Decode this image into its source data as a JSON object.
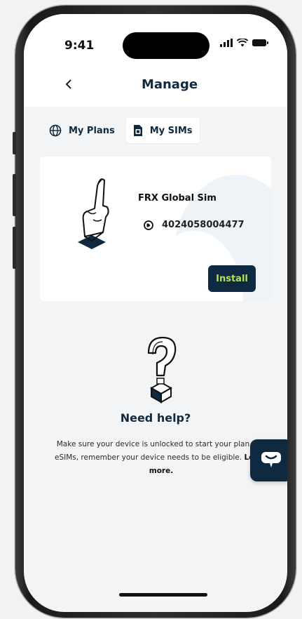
{
  "status_bar": {
    "time": "9:41",
    "icons": [
      "signal-icon",
      "wifi-icon",
      "battery-icon"
    ]
  },
  "header": {
    "back_icon": "chevron-left-icon",
    "title": "Manage"
  },
  "tabs": [
    {
      "label": "My Plans",
      "icon": "globe-icon",
      "active": false
    },
    {
      "label": "My SIMs",
      "icon": "sim-card-icon",
      "active": true
    }
  ],
  "sim_card": {
    "name": "FRX Global Sim",
    "number": "4024058004477",
    "number_icon": "phone-tag-icon",
    "install_label": "Install"
  },
  "help": {
    "title": "Need help?",
    "text": "Make sure your device is unlocked to start your plan. For eSIMs, remember your device needs to be eligible.",
    "learn_more": "Learn more."
  },
  "colors": {
    "navy": "#0f2a40",
    "accent_green": "#b7e05a",
    "background": "#f3f4f5",
    "card": "#ffffff"
  }
}
